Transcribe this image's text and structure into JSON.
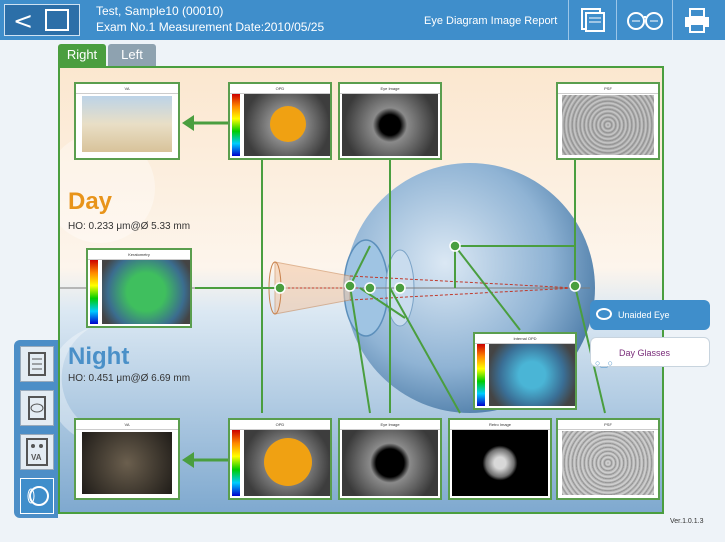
{
  "header": {
    "patient_line": "Test, Sample10 (00010)",
    "exam_line": "Exam No.1 Measurement Date:2010/05/25",
    "report_title": "Eye Diagram Image Report",
    "back_label": "<"
  },
  "tabs": [
    {
      "label": "Right"
    },
    {
      "label": "Left"
    }
  ],
  "day": {
    "title": "Day",
    "ho": "HO: 0.233 μm@Ø 5.33 mm",
    "color": "#e8941a"
  },
  "night": {
    "title": "Night",
    "ho": "HO: 0.451 μm@Ø 6.69 mm",
    "color": "#4a90c8"
  },
  "thumbs": {
    "day_va": "VA",
    "day_opd": "OPD",
    "day_eye": "Eye Image",
    "day_psf": "PSF",
    "keratometry": "Keratometry",
    "internal_opd": "Internal OPD",
    "night_va": "VA",
    "night_opd": "OPD",
    "night_eye": "Eye Image",
    "night_retro": "Retro Image",
    "night_psf": "PSF"
  },
  "buttons": {
    "unaided_eye": "Unaided Eye",
    "day_glasses": "Day Glasses",
    "va_label": "VA"
  },
  "version": "Ver.1.0.1.3",
  "colors": {
    "accent": "#3f8ecb",
    "green": "#4a9e3f"
  }
}
